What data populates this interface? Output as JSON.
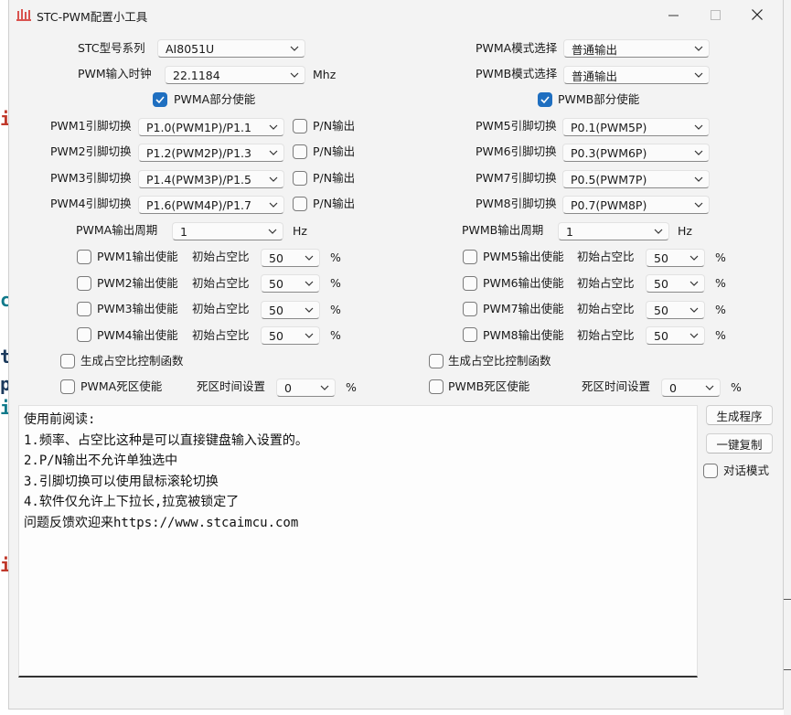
{
  "window": {
    "title": "STC-PWM配置小工具",
    "controls": [
      "minimize",
      "maximize",
      "close"
    ]
  },
  "left": {
    "series_label": "STC型号系列",
    "series_value": "AI8051U",
    "clock_label": "PWM输入时钟",
    "clock_value": "22.1184",
    "clock_unit": "Mhz",
    "pwma_enable_label": "PWMA部分使能",
    "pwma_enable_checked": true,
    "pins": [
      {
        "label": "PWM1引脚切换",
        "value": "P1.0(PWM1P)/P1.1",
        "pn_label": "P/N输出"
      },
      {
        "label": "PWM2引脚切换",
        "value": "P1.2(PWM2P)/P1.3",
        "pn_label": "P/N输出"
      },
      {
        "label": "PWM3引脚切换",
        "value": "P1.4(PWM3P)/P1.5",
        "pn_label": "P/N输出"
      },
      {
        "label": "PWM4引脚切换",
        "value": "P1.6(PWM4P)/P1.7",
        "pn_label": "P/N输出"
      }
    ],
    "period_label": "PWMA输出周期",
    "period_value": "1",
    "period_unit": "Hz",
    "outputs": [
      {
        "label": "PWM1输出使能",
        "duty_label": "初始占空比",
        "duty_value": "50",
        "unit": "%"
      },
      {
        "label": "PWM2输出使能",
        "duty_label": "初始占空比",
        "duty_value": "50",
        "unit": "%"
      },
      {
        "label": "PWM3输出使能",
        "duty_label": "初始占空比",
        "duty_value": "50",
        "unit": "%"
      },
      {
        "label": "PWM4输出使能",
        "duty_label": "初始占空比",
        "duty_value": "50",
        "unit": "%"
      }
    ],
    "gen_func_label": "生成占空比控制函数",
    "dead_label": "PWMA死区使能",
    "dead_time_label": "死区时间设置",
    "dead_time_value": "0",
    "dead_time_unit": "%"
  },
  "right": {
    "mode_a_label": "PWMA模式选择",
    "mode_a_value": "普通输出",
    "mode_b_label": "PWMB模式选择",
    "mode_b_value": "普通输出",
    "pwmb_enable_label": "PWMB部分使能",
    "pwmb_enable_checked": true,
    "pins": [
      {
        "label": "PWM5引脚切换",
        "value": "P0.1(PWM5P)"
      },
      {
        "label": "PWM6引脚切换",
        "value": "P0.3(PWM6P)"
      },
      {
        "label": "PWM7引脚切换",
        "value": "P0.5(PWM7P)"
      },
      {
        "label": "PWM8引脚切换",
        "value": "P0.7(PWM8P)"
      }
    ],
    "period_label": "PWMB输出周期",
    "period_value": "1",
    "period_unit": "Hz",
    "outputs": [
      {
        "label": "PWM5输出使能",
        "duty_label": "初始占空比",
        "duty_value": "50",
        "unit": "%"
      },
      {
        "label": "PWM6输出使能",
        "duty_label": "初始占空比",
        "duty_value": "50",
        "unit": "%"
      },
      {
        "label": "PWM7输出使能",
        "duty_label": "初始占空比",
        "duty_value": "50",
        "unit": "%"
      },
      {
        "label": "PWM8输出使能",
        "duty_label": "初始占空比",
        "duty_value": "50",
        "unit": "%"
      }
    ],
    "gen_func_label": "生成占空比控制函数",
    "dead_label": "PWMB死区使能",
    "dead_time_label": "死区时间设置",
    "dead_time_value": "0",
    "dead_time_unit": "%"
  },
  "actions": {
    "generate_label": "生成程序",
    "copy_label": "一键复制",
    "dialog_label": "对话模式"
  },
  "textarea": {
    "lines": [
      "使用前阅读:",
      "1.频率、占空比这种是可以直接键盘输入设置的。",
      "2.P/N输出不允许单独选中",
      "3.引脚切换可以使用鼠标滚轮切换",
      "4.软件仅允许上下拉长,拉宽被锁定了",
      "问题反馈欢迎来https://www.stcaimcu.com"
    ]
  },
  "colors": {
    "accent": "#1f6fc0",
    "window_bg": "#f3f3f3",
    "control_bg": "#fbfbfb",
    "text": "#1a1a1a"
  }
}
